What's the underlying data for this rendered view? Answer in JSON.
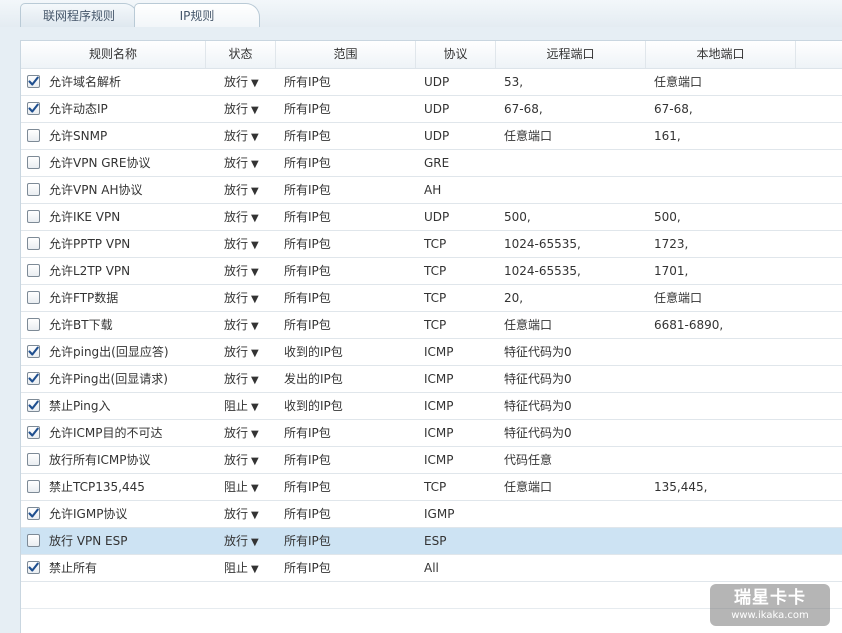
{
  "tabs": [
    {
      "label": "联网程序规则",
      "active": false
    },
    {
      "label": "IP规则",
      "active": true
    }
  ],
  "columns": [
    "规则名称",
    "状态",
    "范围",
    "协议",
    "远程端口",
    "本地端口"
  ],
  "rows": [
    {
      "checked": true,
      "name": "允许域名解析",
      "status": "放行",
      "scope": "所有IP包",
      "protocol": "UDP",
      "remote": "53,",
      "local": "任意端口"
    },
    {
      "checked": true,
      "name": "允许动态IP",
      "status": "放行",
      "scope": "所有IP包",
      "protocol": "UDP",
      "remote": "67-68,",
      "local": "67-68,"
    },
    {
      "checked": false,
      "name": "允许SNMP",
      "status": "放行",
      "scope": "所有IP包",
      "protocol": "UDP",
      "remote": "任意端口",
      "local": "161,"
    },
    {
      "checked": false,
      "name": "允许VPN GRE协议",
      "status": "放行",
      "scope": "所有IP包",
      "protocol": "GRE",
      "remote": "",
      "local": ""
    },
    {
      "checked": false,
      "name": "允许VPN AH协议",
      "status": "放行",
      "scope": "所有IP包",
      "protocol": "AH",
      "remote": "",
      "local": ""
    },
    {
      "checked": false,
      "name": "允许IKE VPN",
      "status": "放行",
      "scope": "所有IP包",
      "protocol": "UDP",
      "remote": "500,",
      "local": "500,"
    },
    {
      "checked": false,
      "name": "允许PPTP VPN",
      "status": "放行",
      "scope": "所有IP包",
      "protocol": "TCP",
      "remote": "1024-65535,",
      "local": "1723,"
    },
    {
      "checked": false,
      "name": "允许L2TP VPN",
      "status": "放行",
      "scope": "所有IP包",
      "protocol": "TCP",
      "remote": "1024-65535,",
      "local": "1701,"
    },
    {
      "checked": false,
      "name": "允许FTP数据",
      "status": "放行",
      "scope": "所有IP包",
      "protocol": "TCP",
      "remote": "20,",
      "local": "任意端口"
    },
    {
      "checked": false,
      "name": "允许BT下载",
      "status": "放行",
      "scope": "所有IP包",
      "protocol": "TCP",
      "remote": "任意端口",
      "local": "6681-6890,"
    },
    {
      "checked": true,
      "name": "允许ping出(回显应答)",
      "status": "放行",
      "scope": "收到的IP包",
      "protocol": "ICMP",
      "remote": "特征代码为0",
      "local": ""
    },
    {
      "checked": true,
      "name": "允许Ping出(回显请求)",
      "status": "放行",
      "scope": "发出的IP包",
      "protocol": "ICMP",
      "remote": "特征代码为0",
      "local": ""
    },
    {
      "checked": true,
      "name": "禁止Ping入",
      "status": "阻止",
      "scope": "收到的IP包",
      "protocol": "ICMP",
      "remote": "特征代码为0",
      "local": ""
    },
    {
      "checked": true,
      "name": "允许ICMP目的不可达",
      "status": "放行",
      "scope": "所有IP包",
      "protocol": "ICMP",
      "remote": "特征代码为0",
      "local": ""
    },
    {
      "checked": false,
      "name": "放行所有ICMP协议",
      "status": "放行",
      "scope": "所有IP包",
      "protocol": "ICMP",
      "remote": "代码任意",
      "local": ""
    },
    {
      "checked": false,
      "name": "禁止TCP135,445",
      "status": "阻止",
      "scope": "所有IP包",
      "protocol": "TCP",
      "remote": "任意端口",
      "local": "135,445,"
    },
    {
      "checked": true,
      "name": "允许IGMP协议",
      "status": "放行",
      "scope": "所有IP包",
      "protocol": "IGMP",
      "remote": "",
      "local": ""
    },
    {
      "checked": false,
      "name": "放行 VPN ESP",
      "status": "放行",
      "scope": "所有IP包",
      "protocol": "ESP",
      "remote": "",
      "local": "",
      "selected": true
    },
    {
      "checked": true,
      "name": "禁止所有",
      "status": "阻止",
      "scope": "所有IP包",
      "protocol": "All",
      "remote": "",
      "local": ""
    }
  ],
  "status_arrow": "▼",
  "watermark": {
    "line1": "瑞星卡卡",
    "line2": "www.ikaka.com"
  },
  "colors": {
    "selected_row": "#cde3f3",
    "check": "#1f4f8f"
  }
}
